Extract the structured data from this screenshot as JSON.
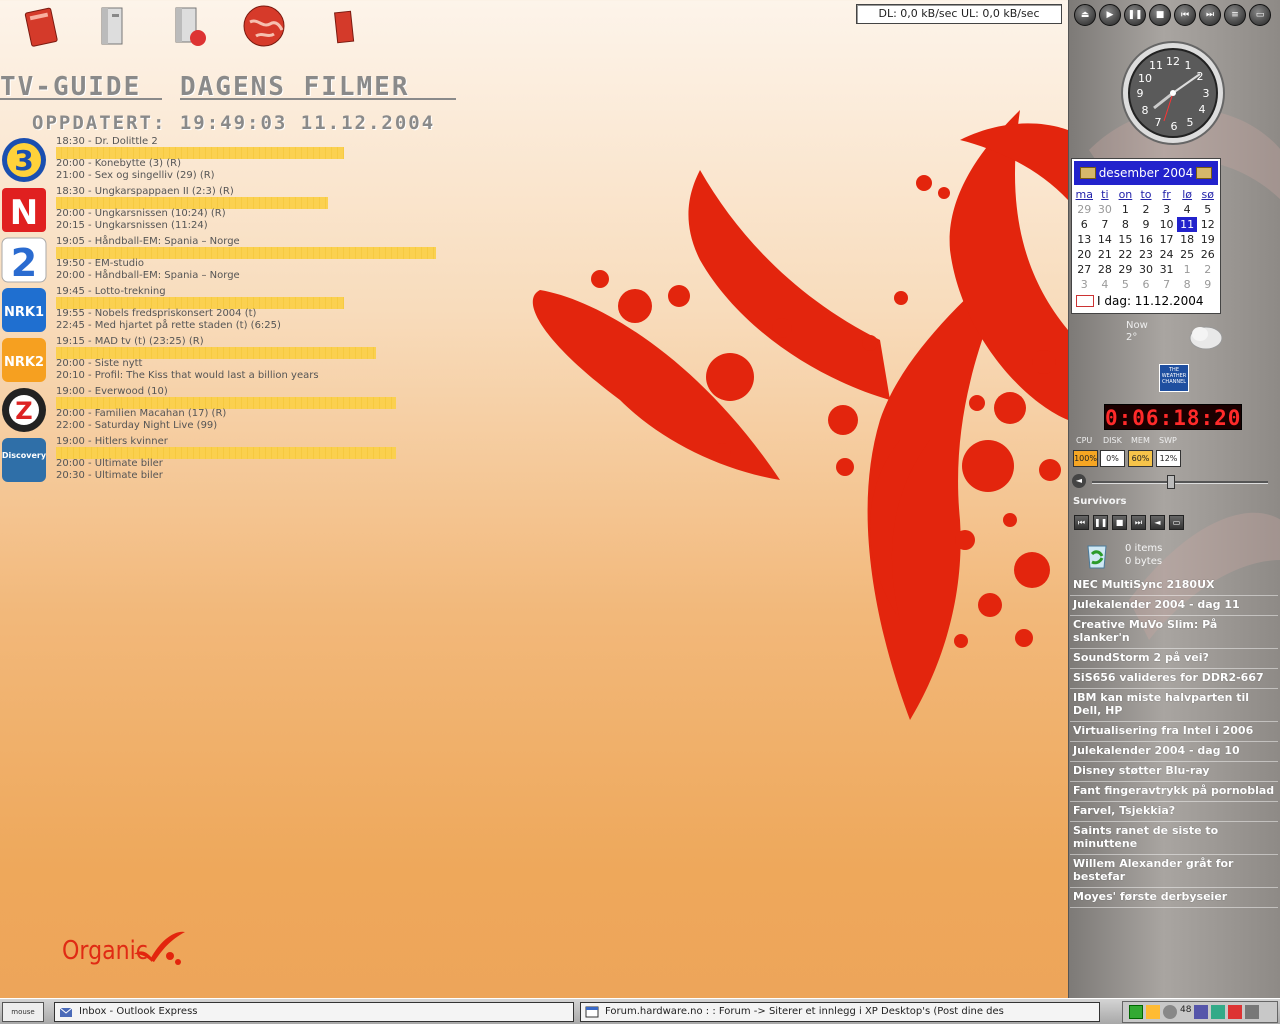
{
  "netmeter": {
    "text": "DL: 0,0 kB/sec  UL: 0,0 kB/sec"
  },
  "headings": {
    "tvguide": "TV-GUIDE",
    "films": "DAGENS FILMER",
    "updated": "OPPDATERT: 19:49:03 11.12.2004"
  },
  "channels": [
    {
      "icon": "tv3-logo-icon",
      "lines": [
        "18:30 - Dr. Dolittle 2",
        "20:00 - Konebytte (3) (R)",
        "21:00 - Sex og singelliv (29) (R)"
      ],
      "progress": 0.72
    },
    {
      "icon": "tvnorge-logo-icon",
      "lines": [
        "18:30 - Ungkarspappaen II (2:3) (R)",
        "20:00 - Ungkarsnissen (10:24) (R)",
        "20:15 - Ungkarsnissen (11:24)"
      ],
      "progress": 0.68
    },
    {
      "icon": "tv2-logo-icon",
      "lines": [
        "19:05 - Håndball-EM: Spania – Norge",
        "19:50 - EM-studio",
        "20:00 - Håndball-EM: Spania – Norge"
      ],
      "progress": 0.95
    },
    {
      "icon": "nrk1-logo-icon",
      "lines": [
        "19:45 - Lotto-trekning",
        "19:55 - Nobels fredspriskonsert 2004 (t)",
        "22:45 - Med hjartet på rette staden (t) (6:25)"
      ],
      "progress": 0.72
    },
    {
      "icon": "nrk2-logo-icon",
      "lines": [
        "19:15 - MAD tv (t) (23:25) (R)",
        "20:00 - Siste nytt",
        "20:10 - Profil: The Kiss that would last a billion years"
      ],
      "progress": 0.8
    },
    {
      "icon": "zebra-logo-icon",
      "lines": [
        "19:00 - Everwood (10)",
        "20:00 - Familien Macahan (17) (R)",
        "22:00 - Saturday Night Live (99)"
      ],
      "progress": 0.85
    },
    {
      "icon": "discovery-logo-icon",
      "lines": [
        "19:00 - Hitlers kvinner",
        "20:00 - Ultimate biler",
        "20:30 - Ultimate biler"
      ],
      "progress": 0.85
    }
  ],
  "wallpaper_brand": "Organic",
  "calendar": {
    "month": "desember 2004",
    "weekdays": [
      "ma",
      "ti",
      "on",
      "to",
      "fr",
      "lø",
      "sø"
    ],
    "days": [
      "29",
      "30",
      "1",
      "2",
      "3",
      "4",
      "5",
      "6",
      "7",
      "8",
      "9",
      "10",
      "11",
      "12",
      "13",
      "14",
      "15",
      "16",
      "17",
      "18",
      "19",
      "20",
      "21",
      "22",
      "23",
      "24",
      "25",
      "26",
      "27",
      "28",
      "29",
      "30",
      "31",
      "1",
      "2",
      "3",
      "4",
      "5",
      "6",
      "7",
      "8",
      "9"
    ],
    "today_label": "I dag: 11.12.2004"
  },
  "weather": {
    "now_label": "Now",
    "temp": "2°",
    "channel_text": "THE WEATHER CHANNEL"
  },
  "uptime_clock": "0:06:18:20",
  "stats": {
    "labels": [
      "CPU",
      "DISK",
      "MEM",
      "SWP"
    ],
    "values": [
      "100%",
      "0%",
      "60%",
      "12%"
    ]
  },
  "volume_level": 0.47,
  "now_playing": "Survivors",
  "recycle": {
    "items": "0 items",
    "bytes": "0 bytes"
  },
  "news": [
    "NEC MultiSync 2180UX",
    "Julekalender 2004 - dag 11",
    "Creative MuVo Slim: På slanker'n",
    "SoundStorm 2 på vei?",
    "SiS656 valideres for DDR2-667",
    "IBM kan miste halvparten til Dell, HP",
    "Virtualisering fra Intel i 2006",
    "Julekalender 2004 - dag 10",
    "Disney støtter Blu-ray",
    "Fant fingeravtrykk på pornoblad",
    "Farvel, Tsjekkia?",
    "Saints ranet de siste to minuttene",
    "Willem Alexander gråt for bestefar",
    "Moyes' første derbyseier"
  ],
  "taskbar": {
    "start_label": "mouse",
    "task1": "Inbox - Outlook Express",
    "task2": "Forum.hardware.no : : Forum -> Siterer et innlegg i XP Desktop's (Post dine des",
    "tray_num": "48"
  },
  "colors": {
    "accent_red": "#e02b14",
    "calendar_blue": "#2222cc"
  }
}
